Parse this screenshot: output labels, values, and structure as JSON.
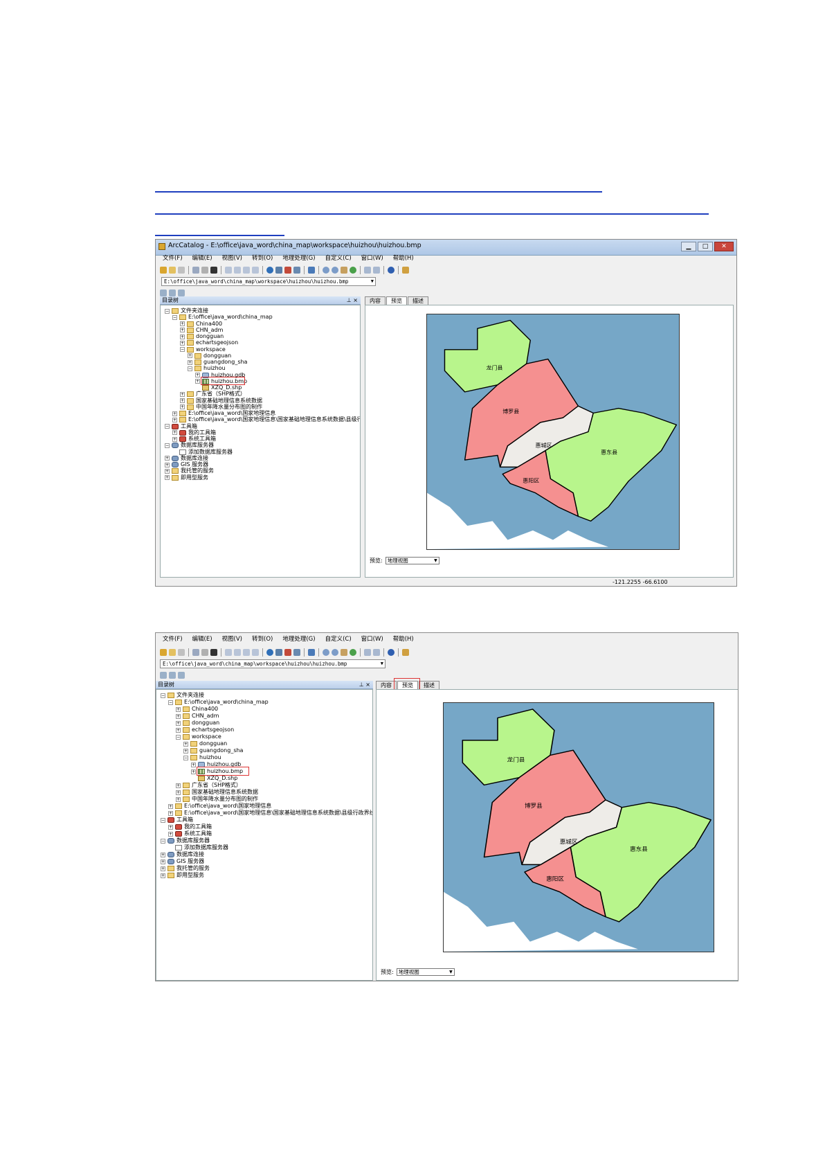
{
  "window": {
    "title": "ArcCatalog - E:\\office\\java_word\\china_map\\workspace\\huizhou\\huizhou.bmp",
    "minimize": "▁",
    "maximize": "□",
    "close": "✕"
  },
  "menu": [
    "文件(F)",
    "编辑(E)",
    "视图(V)",
    "转到(O)",
    "地理处理(G)",
    "自定义(C)",
    "窗口(W)",
    "帮助(H)"
  ],
  "address": "E:\\office\\java_word\\china_map\\workspace\\huizhou\\huizhou.bmp",
  "panel": {
    "title": "目录树",
    "pins": "⊥ ×"
  },
  "tree": [
    {
      "label": "文件夹连接",
      "level": 0,
      "exp": "⊟",
      "icon": "folder"
    },
    {
      "label": "E:\\office\\java_word\\china_map",
      "level": 1,
      "exp": "⊟",
      "icon": "folder"
    },
    {
      "label": "China400",
      "level": 2,
      "exp": "⊞",
      "icon": "folder"
    },
    {
      "label": "CHN_adm",
      "level": 2,
      "exp": "⊞",
      "icon": "folder"
    },
    {
      "label": "dongguan",
      "level": 2,
      "exp": "⊞",
      "icon": "folder"
    },
    {
      "label": "echartsgeojson",
      "level": 2,
      "exp": "⊞",
      "icon": "folder"
    },
    {
      "label": "workspace",
      "level": 2,
      "exp": "⊟",
      "icon": "folder"
    },
    {
      "label": "dongguan",
      "level": 3,
      "exp": "⊞",
      "icon": "folder"
    },
    {
      "label": "guangdong_sha",
      "level": 3,
      "exp": "⊞",
      "icon": "folder"
    },
    {
      "label": "huizhou",
      "level": 3,
      "exp": "⊟",
      "icon": "folder"
    },
    {
      "label": "huizhou.gdb",
      "level": 4,
      "exp": "⊞",
      "icon": "gdb"
    },
    {
      "label": "huizhou.bmp",
      "level": 4,
      "exp": "⊞",
      "icon": "raster",
      "selected": true
    },
    {
      "label": "XZQ_D.shp",
      "level": 4,
      "exp": "",
      "icon": "shp"
    },
    {
      "label": "广东省（SHP格式）",
      "level": 2,
      "exp": "⊞",
      "icon": "folder"
    },
    {
      "label": "国家基础地理信息系统数据",
      "level": 2,
      "exp": "⊞",
      "icon": "folder"
    },
    {
      "label": "中国年降水量分布图的制作",
      "level": 2,
      "exp": "⊞",
      "icon": "folder"
    },
    {
      "label": "E:\\office\\java_word\\国家地理信息",
      "level": 1,
      "exp": "⊞",
      "icon": "folder"
    },
    {
      "label": "E:\\office\\java_word\\国家地理信息\\国家基础地理信息系统数据\\县级行政界线",
      "level": 1,
      "exp": "⊞",
      "icon": "folder"
    },
    {
      "label": "工具箱",
      "level": 0,
      "exp": "⊟",
      "icon": "tool"
    },
    {
      "label": "我的工具箱",
      "level": 1,
      "exp": "⊞",
      "icon": "tool"
    },
    {
      "label": "系统工具箱",
      "level": 1,
      "exp": "⊞",
      "icon": "tool"
    },
    {
      "label": "数据库服务器",
      "level": 0,
      "exp": "⊟",
      "icon": "db"
    },
    {
      "label": "添加数据库服务器",
      "level": 1,
      "exp": "",
      "icon": "add"
    },
    {
      "label": "数据库连接",
      "level": 0,
      "exp": "⊞",
      "icon": "db"
    },
    {
      "label": "GIS 服务器",
      "level": 0,
      "exp": "⊞",
      "icon": "db"
    },
    {
      "label": "我托管的服务",
      "level": 0,
      "exp": "⊞",
      "icon": "folder"
    },
    {
      "label": "即用型服务",
      "level": 0,
      "exp": "⊞",
      "icon": "folder"
    }
  ],
  "tabs": [
    "内容",
    "预览",
    "描述"
  ],
  "active_tab": "预览",
  "preview_label": "预览:",
  "preview_select": "地理视图",
  "map_labels": {
    "longmen": "龙门县",
    "boluo": "博罗县",
    "huicheng": "惠城区",
    "huidong": "惠东县",
    "huiyang": "惠阳区"
  },
  "colors": {
    "sea": "#76a7c7",
    "green": "#b8f58c",
    "red": "#f59090",
    "gray": "#eeece8",
    "land": "#ffffff"
  },
  "statusbar": "-121.2255  -66.6100"
}
